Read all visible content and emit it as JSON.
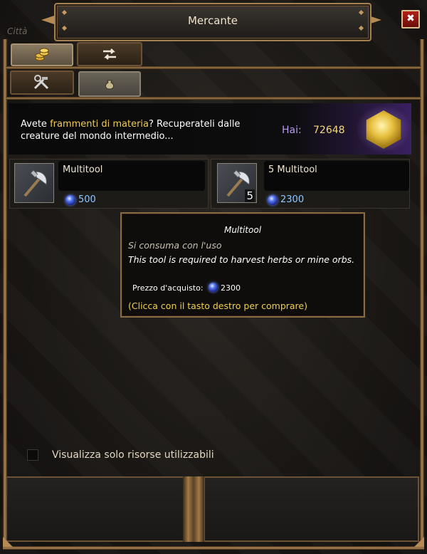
{
  "window": {
    "title": "Mercante",
    "background_location": "Città",
    "close_label": "✖"
  },
  "tabs": {
    "row1": [
      {
        "icon": "coins-icon",
        "state": "unselected"
      },
      {
        "icon": "exchange-arrows-icon",
        "state": "selected"
      }
    ],
    "row2": [
      {
        "icon": "tools-icon",
        "state": "selected"
      },
      {
        "icon": "pouch-icon",
        "state": "unselected"
      }
    ]
  },
  "banner": {
    "text_before": "Avete ",
    "text_highlight": "frammenti di materia",
    "text_after": "? Recuperateli dalle creature del mondo intermedio...",
    "balance_label": "Hai:",
    "balance_value": "72648",
    "icon": "matter-fragment-gem-icon"
  },
  "items": [
    {
      "name": "Multitool",
      "stack": "",
      "price": "500",
      "icon": "axe-icon",
      "currency_icon": "blue-orb-icon"
    },
    {
      "name": "5  Multitool",
      "stack": "5",
      "price": "2300",
      "icon": "axe-icon",
      "currency_icon": "blue-orb-icon"
    }
  ],
  "tooltip": {
    "title": "Multitool",
    "consumable": "Si consuma con l'uso",
    "description": "This tool is required to harvest herbs or mine orbs.",
    "price_label": "Prezzo d'acquisto:",
    "price_value": "2300",
    "hint": "(Clicca con il tasto destro per comprare)"
  },
  "filter": {
    "label": "Visualizza solo risorse utilizzabili",
    "checked": false
  },
  "colors": {
    "accent_gold": "#f2cc52",
    "price_blue": "#8ec8ff",
    "balance_purple": "#b79af0",
    "frame_bronze": "#b58a55"
  }
}
